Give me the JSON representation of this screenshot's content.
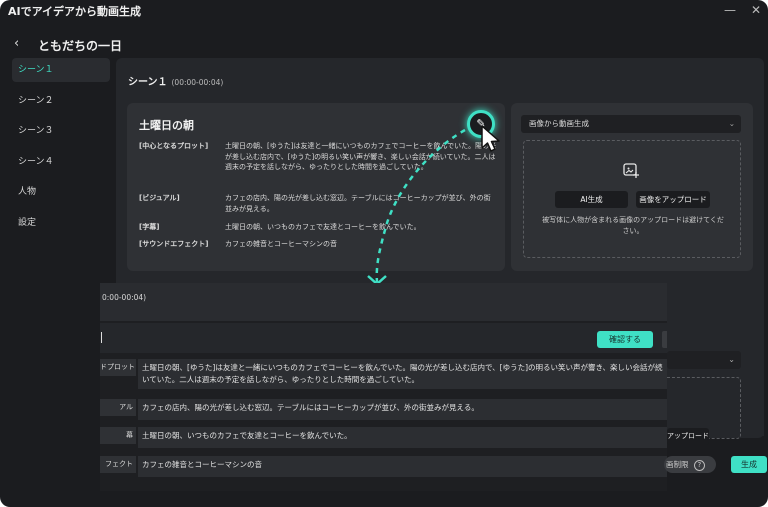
{
  "window": {
    "title": "AIでアイデアから動画生成"
  },
  "header": {
    "back_icon": "‹",
    "project_title": "ともだちの一日"
  },
  "sidebar": {
    "items": [
      {
        "label": "シーン１",
        "active": true
      },
      {
        "label": "シーン２",
        "active": false
      },
      {
        "label": "シーン３",
        "active": false
      },
      {
        "label": "シーン４",
        "active": false
      },
      {
        "label": "人物",
        "active": false
      },
      {
        "label": "設定",
        "active": false
      }
    ]
  },
  "scene": {
    "title": "シーン１",
    "time": "(00:00-00:04)",
    "card_title": "土曜日の朝",
    "rows": [
      {
        "label": "[中心となるプロット]",
        "value": "土曜日の朝、[ゆうた]は友達と一緒にいつものカフェでコーヒーを飲んでいた。陽の光が差し込む店内で、[ゆうた]の明るい笑い声が響き、楽しい会話が続いていた。二人は週末の予定を話しながら、ゆったりとした時間を過ごしていた。"
      },
      {
        "label": "[ビジュアル]",
        "value": "カフェの店内、陽の光が差し込む窓辺。テーブルにはコーヒーカップが並び、外の街並みが見える。"
      },
      {
        "label": "[字幕]",
        "value": "土曜日の朝、いつものカフェで友達とコーヒーを飲んでいた。"
      },
      {
        "label": "[サウンドエフェクト]",
        "value": "カフェの雑音とコーヒーマシンの音"
      }
    ]
  },
  "image_panel": {
    "mode_select": "画像から動画生成",
    "ai_button": "AI生成",
    "upload_button": "画像をアップロード",
    "hint": "被写体に人物が含まれる画像のアップロードは避けてください。"
  },
  "overlay": {
    "time": "0:00-00:04)",
    "confirm_button": "確認する",
    "rows": [
      {
        "label": "ドプロット",
        "value": "土曜日の朝、[ゆうた]は友達と一緒にいつものカフェでコーヒーを飲んでいた。陽の光が差し込む店内で、[ゆうた]の明るい笑い声が響き、楽しい会話が続いていた。二人は週末の予定を話しながら、ゆったりとした時間を過ごしていた。"
      },
      {
        "label": "アル",
        "value": "カフェの店内、陽の光が差し込む窓辺。テーブルにはコーヒーカップが並び、外の街並みが見える。"
      },
      {
        "label": "幕",
        "value": "土曜日の朝、いつものカフェで友達とコーヒーを飲んでいた。"
      },
      {
        "label": "フェクト",
        "value": "カフェの雑音とコーヒーマシンの音"
      }
    ],
    "tail_upload": "アップロード",
    "limit_label": "画制限",
    "generate_button": "生成"
  },
  "colors": {
    "accent": "#3fe0c5",
    "background": "#1b1c1f",
    "panel": "#25272b",
    "card": "#2f3135"
  }
}
